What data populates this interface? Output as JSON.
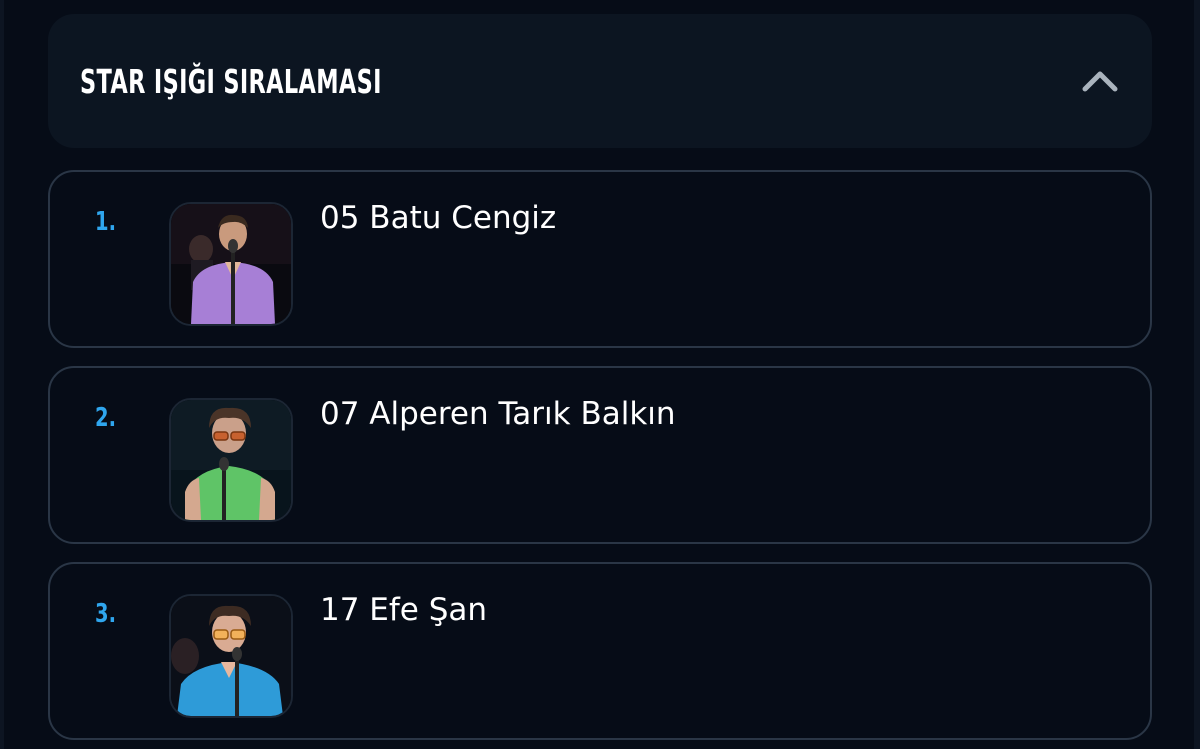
{
  "ranking": {
    "title": "STAR IŞIĞI SIRALAMASI",
    "toggle_icon": "chevron-up-icon",
    "accent_color": "#2fa6ee",
    "items": [
      {
        "rank": "1.",
        "name": "05 Batu Cengiz",
        "shirt_color": "#a77fd6"
      },
      {
        "rank": "2.",
        "name": "07 Alperen Tarık Balkın",
        "shirt_color": "#5fc467"
      },
      {
        "rank": "3.",
        "name": "17 Efe Şan",
        "shirt_color": "#2e9bd8"
      }
    ]
  }
}
